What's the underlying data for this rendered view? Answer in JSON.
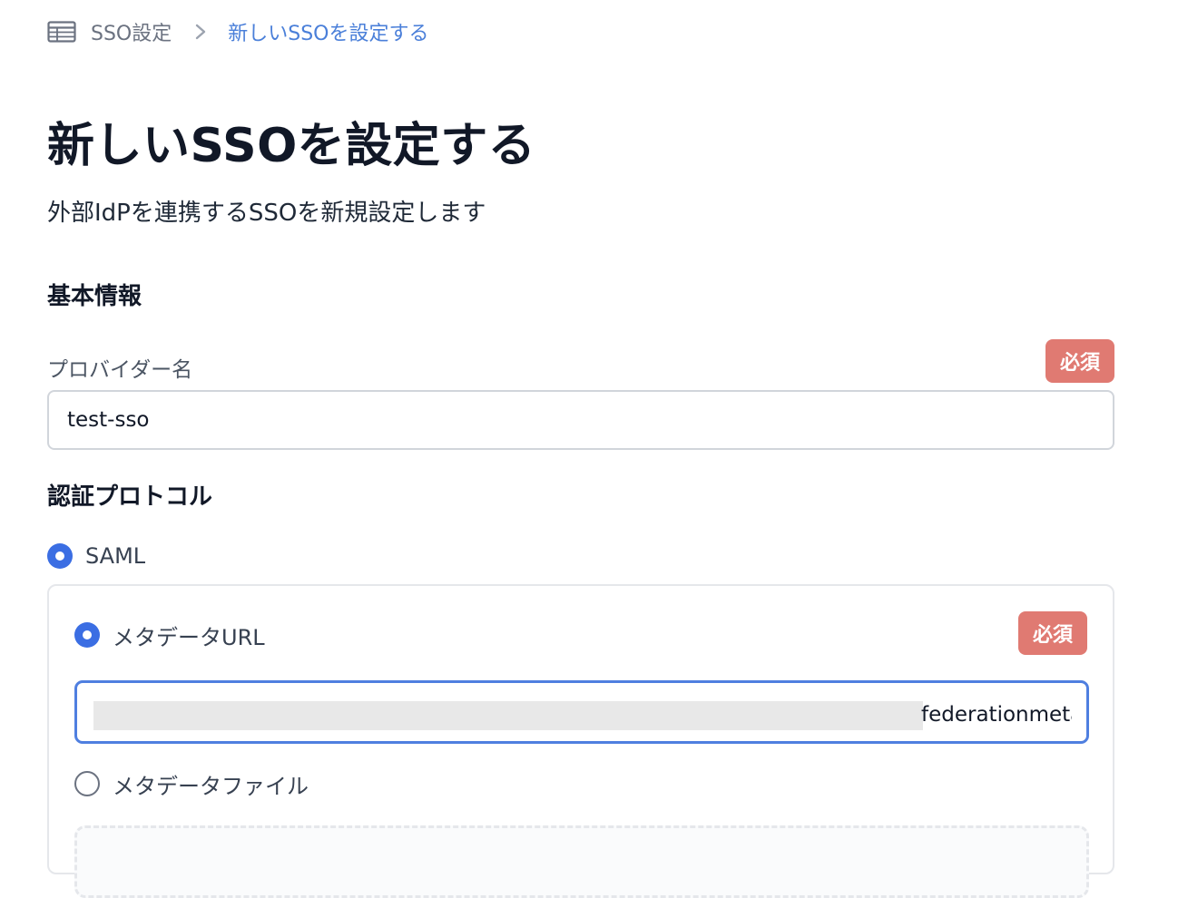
{
  "breadcrumb": {
    "root_label": "SSO設定",
    "current_label": "新しいSSOを設定する"
  },
  "header": {
    "title": "新しいSSOを設定する",
    "description": "外部IdPを連携するSSOを新規設定します"
  },
  "basic_info": {
    "section_title": "基本情報",
    "provider_name": {
      "label": "プロバイダー名",
      "required_label": "必須",
      "value": "test-sso"
    }
  },
  "auth_protocol": {
    "section_title": "認証プロトコル",
    "options": [
      {
        "label": "SAML",
        "selected": true
      }
    ],
    "saml": {
      "required_label": "必須",
      "metadata_url": {
        "label": "メタデータURL",
        "selected": true,
        "value_visible": "federationmeta"
      },
      "metadata_file": {
        "label": "メタデータファイル",
        "selected": false
      }
    }
  },
  "colors": {
    "accent": "#3b6ee3",
    "breadcrumb_link": "#4a7fd9",
    "required_badge": "#e07a72",
    "input_focus_border": "#4f7fe0"
  },
  "icons": {
    "breadcrumb_root": "table-icon",
    "breadcrumb_separator": "chevron-right-icon"
  }
}
